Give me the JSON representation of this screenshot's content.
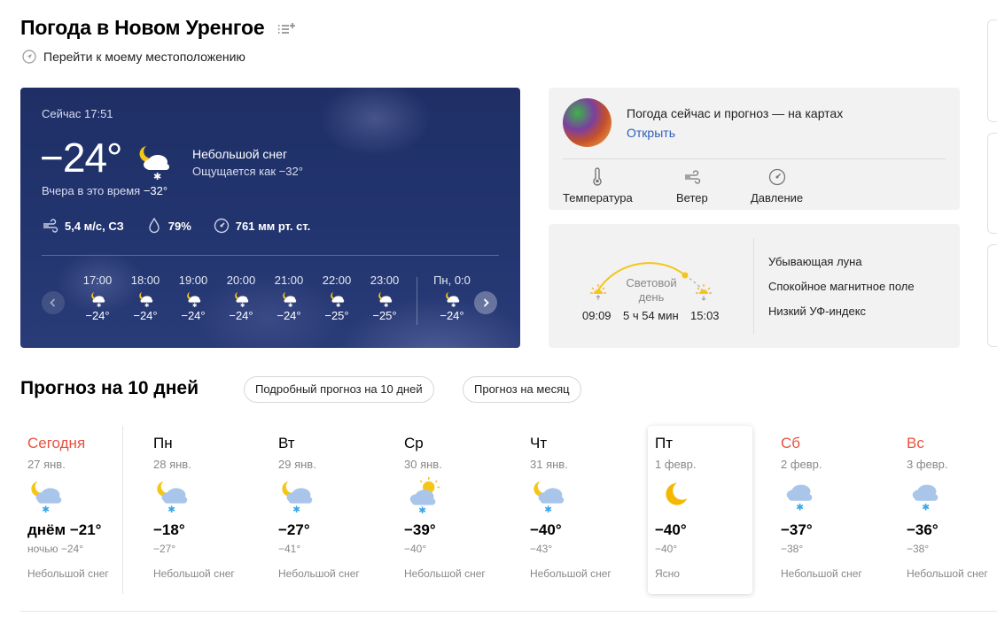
{
  "header": {
    "title": "Погода в Новом Уренгое",
    "location_link": "Перейти к моему местоположению"
  },
  "current": {
    "now_label": "Сейчас 17:51",
    "temp": "−24°",
    "condition": "Небольшой снег",
    "feels_like": "Ощущается как −32°",
    "yesterday_label": "Вчера в это время",
    "yesterday_value": "−32°",
    "wind": "5,4 м/с, СЗ",
    "humidity": "79%",
    "pressure": "761 мм рт. ст.",
    "icon": "night-cloud-snow-icon",
    "hourly": [
      {
        "time": "17:00",
        "temp": "−24°",
        "icon": "night-snow-icon"
      },
      {
        "time": "18:00",
        "temp": "−24°",
        "icon": "night-snow-icon"
      },
      {
        "time": "19:00",
        "temp": "−24°",
        "icon": "night-snow-icon"
      },
      {
        "time": "20:00",
        "temp": "−24°",
        "icon": "night-snow-icon"
      },
      {
        "time": "21:00",
        "temp": "−24°",
        "icon": "night-snow-icon"
      },
      {
        "time": "22:00",
        "temp": "−25°",
        "icon": "night-snow-icon"
      },
      {
        "time": "23:00",
        "temp": "−25°",
        "icon": "night-snow-icon"
      },
      {
        "time": "Пн, 0:0",
        "temp": "−24°",
        "icon": "night-snow-icon"
      }
    ]
  },
  "maps": {
    "title": "Погода сейчас и прогноз — на картах",
    "open_label": "Открыть",
    "layers": [
      {
        "label": "Температура",
        "icon": "thermometer-icon"
      },
      {
        "label": "Ветер",
        "icon": "wind-icon"
      },
      {
        "label": "Давление",
        "icon": "gauge-icon"
      }
    ]
  },
  "sun": {
    "sunrise": "09:09",
    "sunset": "15:03",
    "day_label_1": "Световой",
    "day_label_2": "день",
    "day_length": "5 ч 54 мин",
    "moon": "Убывающая луна",
    "magnetic": "Спокойное магнитное поле",
    "uv": "Низкий УФ-индекс"
  },
  "forecast": {
    "title": "Прогноз на 10 дней",
    "detailed_btn": "Подробный прогноз на 10 дней",
    "month_btn": "Прогноз на месяц",
    "days": [
      {
        "name": "Сегодня",
        "date": "27 янв.",
        "max": "днём −21°",
        "min": "ночью −24°",
        "cond": "Небольшой снег",
        "weekend": true,
        "icon": "night-cloud-snow-icon"
      },
      {
        "name": "Пн",
        "date": "28 янв.",
        "max": "−18°",
        "min": "−27°",
        "cond": "Небольшой снег",
        "weekend": false,
        "icon": "night-cloud-snow-icon"
      },
      {
        "name": "Вт",
        "date": "29 янв.",
        "max": "−27°",
        "min": "−41°",
        "cond": "Небольшой снег",
        "weekend": false,
        "icon": "night-cloud-snow-icon"
      },
      {
        "name": "Ср",
        "date": "30 янв.",
        "max": "−39°",
        "min": "−40°",
        "cond": "Небольшой снег",
        "weekend": false,
        "icon": "sun-cloud-snow-icon"
      },
      {
        "name": "Чт",
        "date": "31 янв.",
        "max": "−40°",
        "min": "−43°",
        "cond": "Небольшой снег",
        "weekend": false,
        "icon": "night-cloud-snow-icon"
      },
      {
        "name": "Пт",
        "date": "1 февр.",
        "max": "−40°",
        "min": "−40°",
        "cond": "Ясно",
        "weekend": false,
        "icon": "moon-icon"
      },
      {
        "name": "Сб",
        "date": "2 февр.",
        "max": "−37°",
        "min": "−38°",
        "cond": "Небольшой снег",
        "weekend": true,
        "icon": "cloud-snow-icon"
      },
      {
        "name": "Вс",
        "date": "3 февр.",
        "max": "−36°",
        "min": "−38°",
        "cond": "Небольшой снег",
        "weekend": true,
        "icon": "cloud-snow-icon"
      }
    ]
  },
  "colors": {
    "card_bg": "#22346e",
    "weekend": "#e8523f",
    "link": "#2b5fb8",
    "sun": "#f5c518"
  }
}
